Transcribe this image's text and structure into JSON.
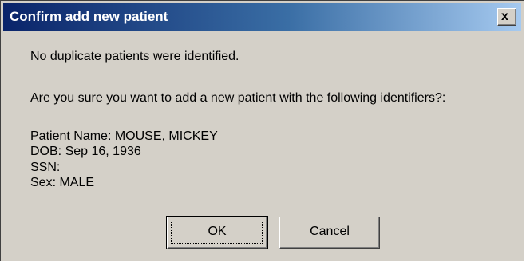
{
  "dialog": {
    "title": "Confirm add new patient",
    "close_icon": "close-icon",
    "close_glyph": "x",
    "messages": {
      "no_duplicates": "No duplicate patients were identified.",
      "confirm_question": "Are you sure you want to add a new patient with the following identifiers?:"
    },
    "identifiers": {
      "patient_name": "Patient Name: MOUSE, MICKEY",
      "dob": "DOB: Sep 16, 1936",
      "ssn": "SSN:",
      "sex": "Sex: MALE"
    },
    "buttons": {
      "ok_label": "OK",
      "cancel_label": "Cancel"
    },
    "colors": {
      "titlebar_start": "#0a246a",
      "titlebar_end": "#a6caf0",
      "face": "#d4d0c8"
    }
  }
}
